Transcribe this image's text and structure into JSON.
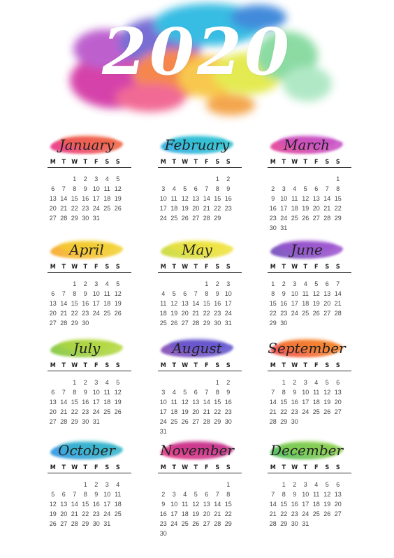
{
  "year": "2020",
  "weekday_labels": [
    "M",
    "T",
    "W",
    "T",
    "F",
    "S",
    "S"
  ],
  "months": [
    {
      "name": "January",
      "offset": 2,
      "days": 31,
      "colors": [
        "#e8247d",
        "#f0623a"
      ]
    },
    {
      "name": "February",
      "offset": 5,
      "days": 29,
      "colors": [
        "#1fa7e0",
        "#27c0d0"
      ]
    },
    {
      "name": "March",
      "offset": 6,
      "days": 31,
      "colors": [
        "#e0338f",
        "#c44bc7"
      ]
    },
    {
      "name": "April",
      "offset": 2,
      "days": 30,
      "colors": [
        "#f7a31c",
        "#f2d22a"
      ]
    },
    {
      "name": "May",
      "offset": 4,
      "days": 31,
      "colors": [
        "#c6d62b",
        "#f2e33a"
      ]
    },
    {
      "name": "June",
      "offset": 0,
      "days": 30,
      "colors": [
        "#6a3fb5",
        "#9c4fd0"
      ]
    },
    {
      "name": "July",
      "offset": 2,
      "days": 31,
      "colors": [
        "#7ac231",
        "#b5d83a"
      ]
    },
    {
      "name": "August",
      "offset": 5,
      "days": 31,
      "colors": [
        "#7b3fb0",
        "#5a4fd0"
      ]
    },
    {
      "name": "September",
      "offset": 1,
      "days": 30,
      "colors": [
        "#ef3b3b",
        "#f5821f"
      ]
    },
    {
      "name": "October",
      "offset": 3,
      "days": 31,
      "colors": [
        "#1f8fe0",
        "#2fb6c8"
      ]
    },
    {
      "name": "November",
      "offset": 6,
      "days": 30,
      "colors": [
        "#e2257a",
        "#c42f8a"
      ]
    },
    {
      "name": "December",
      "offset": 1,
      "days": 31,
      "colors": [
        "#3fb54a",
        "#8bd04a"
      ]
    }
  ]
}
